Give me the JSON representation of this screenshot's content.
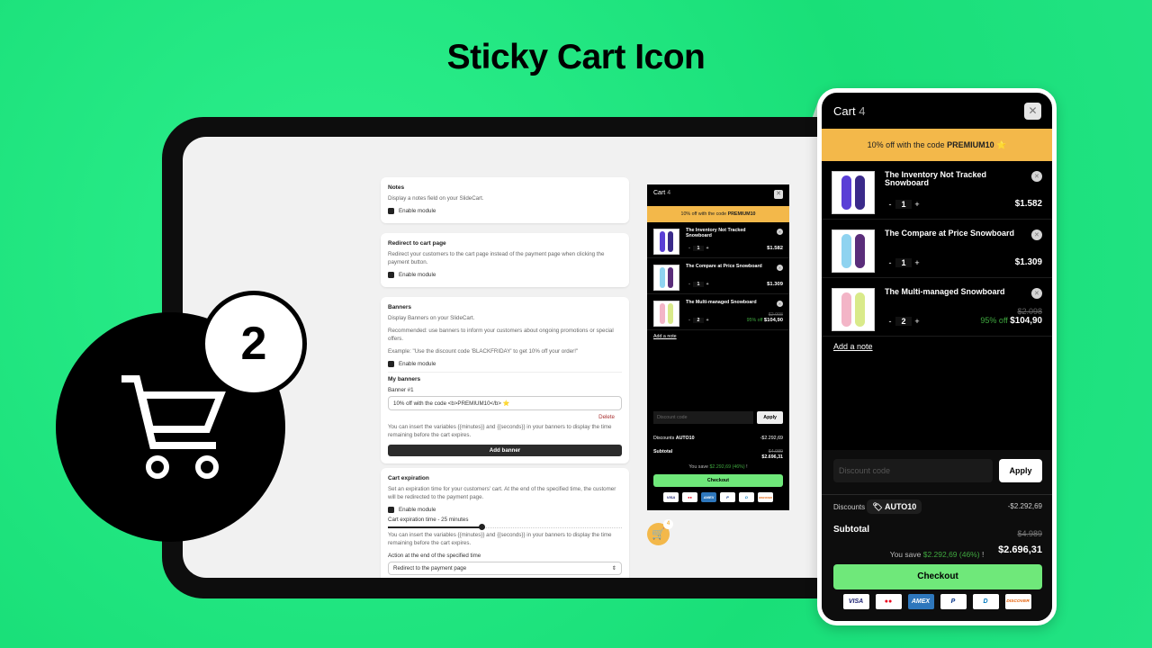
{
  "title": "Sticky Cart Icon",
  "badge_count": "2",
  "settings": {
    "notes": {
      "title": "Notes",
      "desc": "Display a notes field on your SlideCart.",
      "enable": "Enable module"
    },
    "redirect": {
      "title": "Redirect to cart page",
      "desc": "Redirect your customers to the cart page instead of the payment page when clicking the payment button.",
      "enable": "Enable module"
    },
    "banners": {
      "title": "Banners",
      "desc": "Display Banners on your SlideCart.",
      "recommended": "Recommended: use banners to inform your customers about ongoing promotions or special offers.",
      "example": "Example: \"Use the discount code 'BLACKFRIDAY' to get 10% off your order!\"",
      "enable": "Enable module",
      "my_banners": "My banners",
      "banner_label": "Banner #1",
      "banner_value": "10% off with the code <b>PREMIUM10</b> ⭐",
      "delete": "Delete",
      "hint": "You can insert the variables {{minutes}} and {{seconds}} in your banners to display the time remaining before the cart expires.",
      "add": "Add banner"
    },
    "expiration": {
      "title": "Cart expiration",
      "desc": "Set an expiration time for your customers' cart. At the end of the specified time, the customer will be redirected to the payment page.",
      "enable": "Enable module",
      "time_label": "Cart expiration time - 25 minutes",
      "slider_fraction": 0.4,
      "hint": "You can insert the variables {{minutes}} and {{seconds}} in your banners to display the time remaining before the cart expires.",
      "action_label": "Action at the end of the specified time",
      "action_value": "Redirect to the payment page"
    }
  },
  "cart": {
    "title": "Cart",
    "count": "4",
    "banner_text": "10% off with the code ",
    "banner_code": "PREMIUM10",
    "banner_icon": "⭐",
    "items": [
      {
        "name": "The Inventory Not Tracked Snowboard",
        "qty": "1",
        "price": "$1.582",
        "old": "",
        "off": "",
        "colors": [
          "#5a3fd6",
          "#3a2a8a"
        ]
      },
      {
        "name": "The Compare at Price Snowboard",
        "qty": "1",
        "price": "$1.309",
        "old": "",
        "off": "",
        "colors": [
          "#8fd3f0",
          "#5a2d7a"
        ]
      },
      {
        "name": "The Multi-managed Snowboard",
        "qty": "2",
        "price": "$104,90",
        "old": "$2.098",
        "off": "95% off",
        "colors": [
          "#f3b5c7",
          "#d9ea8a"
        ]
      }
    ],
    "add_note": "Add a note",
    "discount_placeholder": "Discount code",
    "apply": "Apply",
    "discounts_label": "Discounts",
    "discount_code": "AUTO10",
    "discount_amount": "-$2.292,69",
    "subtotal_label": "Subtotal",
    "subtotal_old": "$4.989",
    "subtotal": "$2.696,31",
    "save_prefix": "You save ",
    "save_amount": "$2.292,69 (46%)",
    "save_suffix": " !",
    "checkout": "Checkout",
    "payments": [
      "VISA",
      "●●",
      "AMEX",
      "P",
      "D",
      "DISCOVER"
    ]
  },
  "colors": {
    "banner": "#f3b84a",
    "checkout": "#6fe87a",
    "save": "#3fa83f",
    "bg": "#1ee27e"
  }
}
